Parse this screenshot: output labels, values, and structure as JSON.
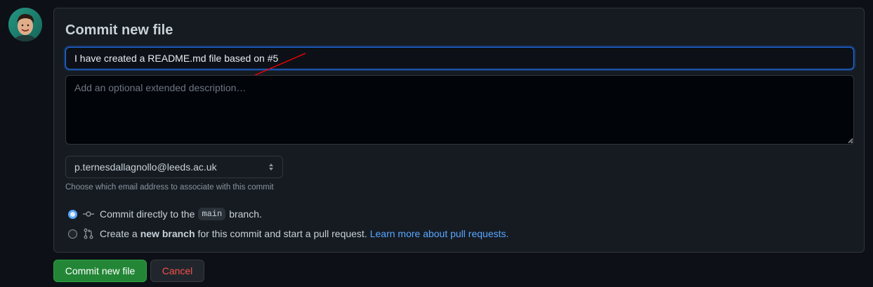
{
  "form": {
    "title": "Commit new file",
    "summary_value": "I have created a README.md file based on #5",
    "description_placeholder": "Add an optional extended description…",
    "description_value": ""
  },
  "email": {
    "selected": "p.ternesdallagnollo@leeds.ac.uk",
    "note": "Choose which email address to associate with this commit"
  },
  "options": {
    "direct": {
      "checked": true,
      "prefix": "Commit directly to the",
      "branch": "main",
      "suffix": "branch."
    },
    "new_branch": {
      "checked": false,
      "prefix": "Create a",
      "bold": "new branch",
      "suffix": "for this commit and start a pull request.",
      "link": "Learn more about pull requests."
    }
  },
  "buttons": {
    "commit": "Commit new file",
    "cancel": "Cancel"
  },
  "icons": {
    "avatar": "user-avatar",
    "commit": "git-commit-icon",
    "pull_request": "git-pull-request-icon",
    "select": "select-arrows-icon"
  },
  "colors": {
    "background": "#0d1117",
    "panel": "#161b22",
    "accent_blue": "#58a6ff",
    "commit_green": "#238636",
    "cancel_red": "#f85149",
    "annotation_red": "#ff0000"
  }
}
